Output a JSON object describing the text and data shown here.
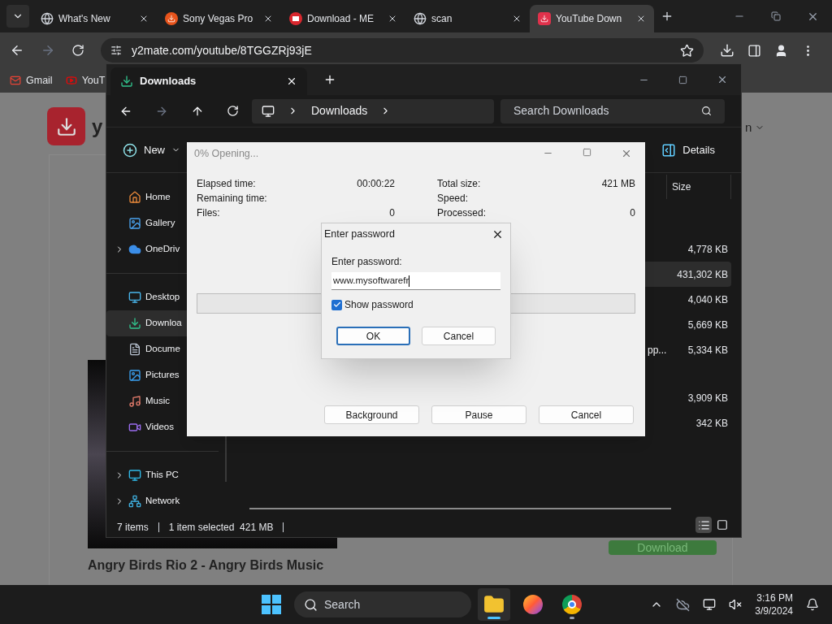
{
  "browser": {
    "tabs": [
      {
        "title": "What's New",
        "selected": false
      },
      {
        "title": "Sony Vegas Pro",
        "selected": false
      },
      {
        "title": "Download - ME",
        "selected": false
      },
      {
        "title": "scan",
        "selected": false
      },
      {
        "title": "YouTube Down",
        "selected": true
      }
    ],
    "address": "y2mate.com/youtube/8TGGZRj93jE",
    "bookmarks": [
      "Gmail",
      "YouT"
    ]
  },
  "page": {
    "logo_text": "y",
    "account_fragment": "n",
    "video_title": "Angry Birds Rio 2 - Angry Birds Music",
    "download_button": "Download"
  },
  "explorer": {
    "tab_title": "Downloads",
    "breadcrumb": [
      "Downloads"
    ],
    "search_placeholder": "Search Downloads",
    "new_button": "New",
    "details_button": "Details",
    "sidebar_groups": [
      {
        "items": [
          {
            "label": "Home",
            "expandable": false,
            "selected": false
          },
          {
            "label": "Gallery",
            "expandable": false,
            "selected": false
          },
          {
            "label": "OneDriv",
            "expandable": true,
            "selected": false
          }
        ]
      },
      {
        "items": [
          {
            "label": "Desktop",
            "expandable": false,
            "selected": false
          },
          {
            "label": "Downloa",
            "expandable": false,
            "selected": true
          },
          {
            "label": "Docume",
            "expandable": false,
            "selected": false
          },
          {
            "label": "Pictures",
            "expandable": false,
            "selected": false
          },
          {
            "label": "Music",
            "expandable": false,
            "selected": false
          },
          {
            "label": "Videos",
            "expandable": false,
            "selected": false
          }
        ]
      },
      {
        "items": [
          {
            "label": "This PC",
            "expandable": true,
            "selected": false
          },
          {
            "label": "Network",
            "expandable": true,
            "selected": false
          }
        ]
      }
    ],
    "size_column": "Size",
    "file_groups": [
      {
        "files": [
          {
            "size": "4,778 KB",
            "selected": false
          },
          {
            "size": "431,302 KB",
            "selected": true
          },
          {
            "size": "4,040 KB",
            "selected": false
          },
          {
            "size": "5,669 KB",
            "selected": false
          },
          {
            "name": "pp...",
            "size": "5,334 KB",
            "selected": false
          }
        ]
      },
      {
        "files": [
          {
            "size": "3,909 KB",
            "selected": false
          },
          {
            "size": "342 KB",
            "selected": false
          }
        ]
      }
    ],
    "status": [
      "7 items",
      "1 item selected  421 MB"
    ],
    "views": [
      {
        "kind": "details",
        "selected": true
      },
      {
        "kind": "tiles",
        "selected": false
      }
    ]
  },
  "progress_dialog": {
    "title": "0% Opening...",
    "left_stats": [
      {
        "label": "Elapsed time:",
        "value": "00:00:22"
      },
      {
        "label": "Remaining time:"
      },
      {
        "label": "Files:",
        "value": "0"
      }
    ],
    "right_stats": [
      {
        "label": "Total size:",
        "value": "421 MB"
      },
      {
        "label": "Speed:"
      },
      {
        "label": "Processed:",
        "value": "0"
      }
    ],
    "level": 0,
    "buttons": [
      "Background",
      "Pause",
      "Cancel"
    ]
  },
  "password_dialog": {
    "title": "Enter password",
    "label": "Enter password:",
    "value": "www.mysoftwarefr",
    "show_password": {
      "label": "Show password",
      "checked": true
    },
    "buttons": [
      {
        "label": "OK",
        "default": true
      },
      {
        "label": "Cancel",
        "default": false
      }
    ]
  },
  "taskbar": {
    "search_placeholder": "Search",
    "apps": [
      {
        "kind": "explorer",
        "selected": true,
        "running": true
      },
      {
        "kind": "firefox",
        "selected": false,
        "running": false
      },
      {
        "kind": "chrome",
        "selected": false,
        "running": true
      }
    ],
    "time": "3:16 PM",
    "date": "3/9/2024"
  }
}
